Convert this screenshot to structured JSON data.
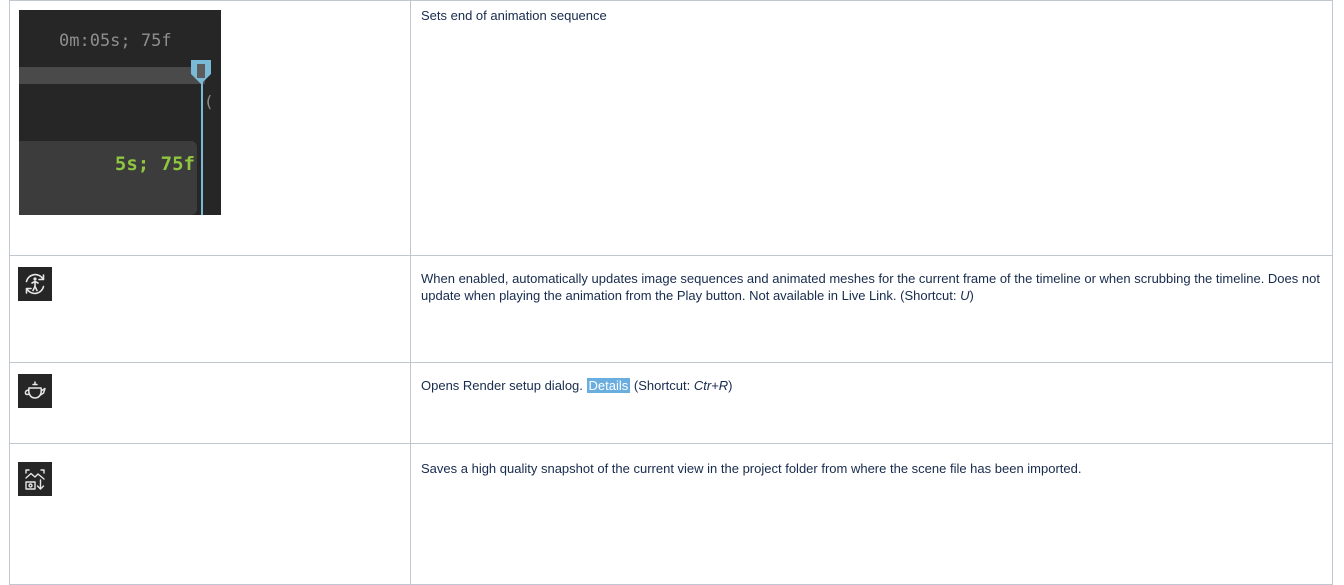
{
  "timeline": {
    "time_readout": "0m:05s; 75f",
    "frame_readout": "5s; 75f",
    "paren": "(",
    "colors": {
      "background": "#262626",
      "track": "#4a4a4a",
      "marker": "#7bbad6",
      "frame_text": "#8fc640"
    }
  },
  "rows": [
    {
      "icon": "end-marker-timeline",
      "description": "Sets end of animation sequence"
    },
    {
      "icon": "auto-update-icon",
      "description": "When enabled, automatically updates image sequences and animated meshes for the current frame of the timeline or when scrubbing the timeline. Does not update when playing the animation from the Play button. Not available in Live Link. (Shortcut: ",
      "shortcut": "U",
      "suffix": ")"
    },
    {
      "icon": "teapot-icon",
      "description": "Opens Render setup dialog. ",
      "link": "Details",
      "shortcut_prefix": " (Shortcut: ",
      "shortcut": "Ctr+R",
      "suffix": ")"
    },
    {
      "icon": "snapshot-icon",
      "description": "Saves a high quality snapshot of the current view in the project folder from where the scene file has been imported."
    }
  ]
}
